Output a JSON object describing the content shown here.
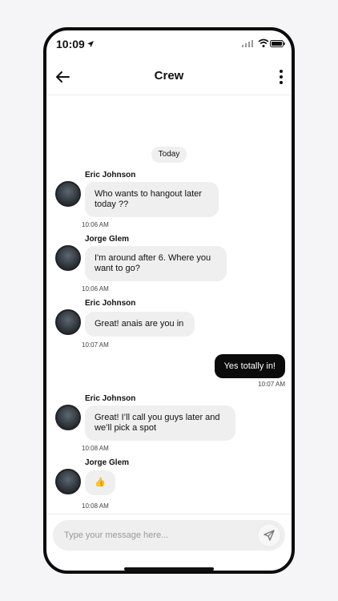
{
  "status": {
    "time": "10:09"
  },
  "header": {
    "title": "Crew"
  },
  "date": "Today",
  "messages": [
    {
      "sender": "Eric Johnson",
      "text": "Who wants to hangout later today ??",
      "time": "10:06 AM"
    },
    {
      "sender": "Jorge Glem",
      "text": "I'm around after 6. Where you want to go?",
      "time": "10:06 AM"
    },
    {
      "sender": "Eric Johnson",
      "text": "Great! anais are you in",
      "time": "10:07 AM"
    },
    {
      "sender": "me",
      "text": "Yes totally in!",
      "time": "10:07 AM"
    },
    {
      "sender": "Eric Johnson",
      "text": "Great! I’ll call you guys later and we’ll pick a spot",
      "time": "10:08 AM"
    },
    {
      "sender": "Jorge Glem",
      "text": "👍",
      "time": "10:08 AM"
    }
  ],
  "composer": {
    "placeholder": "Type your message here..."
  },
  "colors": {
    "outgoing_bubble": "#0b0b0b",
    "incoming_bubble": "#efefef"
  }
}
